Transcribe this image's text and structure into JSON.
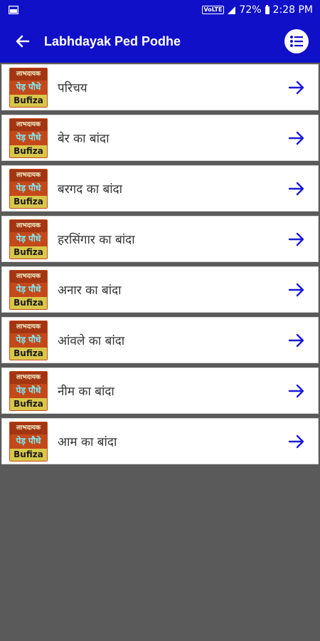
{
  "status_bar": {
    "volte": "VoLTE",
    "battery": "72%",
    "time": "2:28 PM"
  },
  "app_bar": {
    "title": "Labhdayak Ped Podhe"
  },
  "thumbnail": {
    "line1": "लाभदायक",
    "line2": "पेड़ पौधे",
    "line3": "Bufiza"
  },
  "items": [
    {
      "label": "परिचय"
    },
    {
      "label": "बेर का बांदा"
    },
    {
      "label": "बरगद का बांदा"
    },
    {
      "label": "हरसिंगार का बांदा"
    },
    {
      "label": "अनार का बांदा"
    },
    {
      "label": "आंवले का बांदा"
    },
    {
      "label": "नीम का बांदा"
    },
    {
      "label": "आम का बांदा"
    }
  ],
  "colors": {
    "primary": "#1010c8",
    "background": "#5a5a5a",
    "arrow": "#1a1ad8"
  }
}
